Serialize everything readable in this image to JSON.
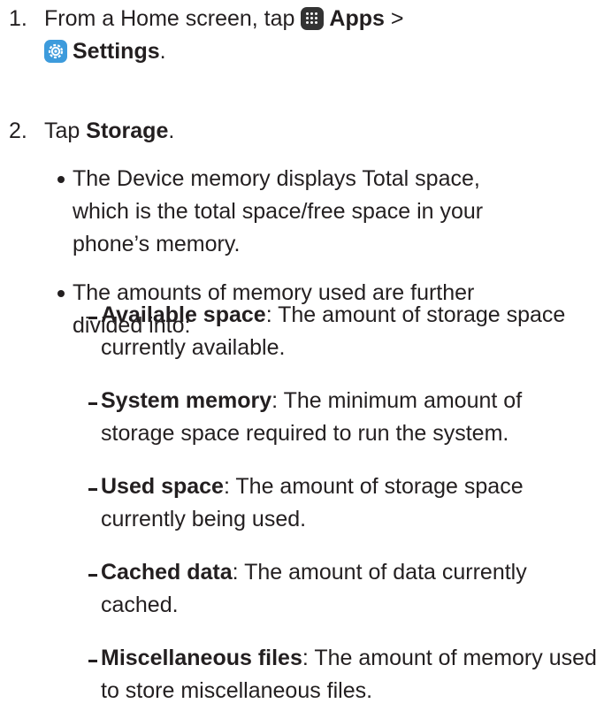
{
  "steps": [
    {
      "number": "1.",
      "prefix": "From a Home screen, tap ",
      "apps_label": "Apps",
      "separator": " >",
      "settings_label": "Settings",
      "suffix": "."
    },
    {
      "number": "2.",
      "prefix": "Tap ",
      "storage_label": "Storage",
      "suffix": "."
    }
  ],
  "bullets": [
    {
      "text": "The Device memory displays Total space, which is the total space/free space in your phone’s memory."
    },
    {
      "text": "The amounts of memory used are further divided into:"
    }
  ],
  "sub_items": [
    {
      "term": "Available space",
      "desc": ": The amount of storage space currently available."
    },
    {
      "term": "System memory",
      "desc": ": The minimum amount of storage space required to run the system."
    },
    {
      "term": "Used space",
      "desc": ": The amount of storage space currently being used."
    },
    {
      "term": "Cached data",
      "desc": ": The amount of data currently cached."
    },
    {
      "term": "Miscellaneous files",
      "desc": ": The amount of memory used to store miscellaneous files."
    }
  ],
  "icons": {
    "apps": "apps-grid-icon",
    "settings": "settings-gear-icon"
  },
  "colors": {
    "text": "#231f20",
    "apps_icon_bg": "#333333",
    "settings_icon_bg": "#3d9bdc"
  }
}
